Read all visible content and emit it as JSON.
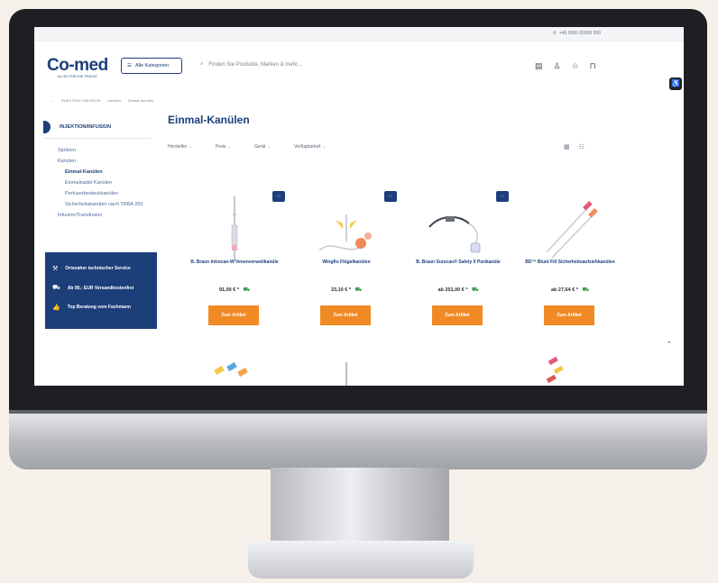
{
  "topbar": {
    "phone": "+49 0000 00000 999"
  },
  "header": {
    "logo_main": "Co-med",
    "logo_tagline": "ALLES FÜR DIE PRAXIS",
    "categories_button": "Alle Kategorien",
    "search_placeholder": "Finden Sie Produkte, Marken & mehr..."
  },
  "breadcrumb": [
    "INJEKTION / INFUSION",
    "Kanülen",
    "Einmal-Kanülen"
  ],
  "sidebar": {
    "title": "INJEKTION/INFUSION",
    "items": [
      {
        "label": "Spritzen",
        "level": 0,
        "active": false
      },
      {
        "label": "Kanülen",
        "level": 0,
        "active": false
      },
      {
        "label": "Einmal-Kanülen",
        "level": 1,
        "active": true
      },
      {
        "label": "Einmalnadel Kanülen",
        "level": 1,
        "active": false
      },
      {
        "label": "Perfusorbesteckkanülen",
        "level": 1,
        "active": false
      },
      {
        "label": "Sicherheitskanülen nach TRBA 250",
        "level": 1,
        "active": false
      },
      {
        "label": "Infusion/Transfusion",
        "level": 0,
        "active": false
      }
    ],
    "service_box": [
      {
        "icon": "wrench-icon",
        "label": "Ortsnaher technischer Service"
      },
      {
        "icon": "truck-icon",
        "label": "Ab 90,- EUR Versandkostenfrei"
      },
      {
        "icon": "thumbs-up-icon",
        "label": "Top Beratung vom Fachmann"
      }
    ]
  },
  "main": {
    "title": "Einmal-Kanülen",
    "filters": [
      "Hersteller",
      "Preis",
      "Gerät",
      "Verfügbarkeit"
    ],
    "products": [
      {
        "name": "B. Braun Introcan-W Venenverweilkanüle",
        "price": "91,00 € *",
        "cta": "Zum Artikel"
      },
      {
        "name": "Wingflo Flügelkanülen",
        "price": "23,10 € *",
        "cta": "Zum Artikel"
      },
      {
        "name": "B. Braun Surecan® Safety II Portkanüle",
        "price": "ab 251,00 € *",
        "cta": "Zum Artikel"
      },
      {
        "name": "BD™ Blunt Fill Sicherheitsaufziehkanülen",
        "price": "ab 27,64 € *",
        "cta": "Zum Artikel"
      }
    ]
  },
  "colors": {
    "brand": "#1c3f7a",
    "cta": "#f08a24",
    "stock": "#3fa34d"
  }
}
